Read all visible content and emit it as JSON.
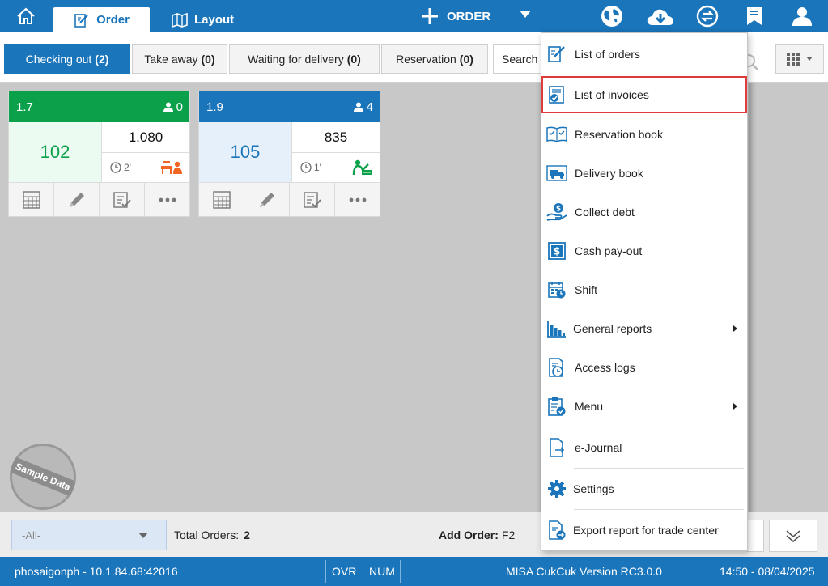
{
  "topbar": {
    "tabs": [
      {
        "label": "Order",
        "icon": "order-edit-icon",
        "active": true
      },
      {
        "label": "Layout",
        "icon": "map-icon",
        "active": false
      }
    ],
    "new_label": "ORDER",
    "icons": [
      "menu-icon",
      "globe-icon",
      "cloud-download-icon",
      "sync-icon",
      "bookmark-icon",
      "user-icon"
    ]
  },
  "status_tabs": [
    {
      "label": "Checking out",
      "count": "(2)",
      "active": true
    },
    {
      "label": "Take away",
      "count": "(0)",
      "active": false
    },
    {
      "label": "Waiting for delivery",
      "count": "(0)",
      "active": false
    },
    {
      "label": "Reservation",
      "count": "(0)",
      "active": false
    }
  ],
  "search": {
    "placeholder": "Search"
  },
  "orders": [
    {
      "table_no": "1.7",
      "guests": "0",
      "table_name": "102",
      "amount": "1.080",
      "elapsed": "2'",
      "header_color": "#0ba04a",
      "type_icon": "dine-in-icon"
    },
    {
      "table_no": "1.9",
      "guests": "4",
      "table_name": "105",
      "amount": "835",
      "elapsed": "1'",
      "header_color": "#1a75bb",
      "type_icon": "waiter-icon"
    }
  ],
  "stamp": "Sample Data",
  "bottom": {
    "filter_value": "-All-",
    "total_label": "Total Orders:",
    "total_value": "2",
    "add_order_label": "Add Order:",
    "add_order_key": "F2"
  },
  "footer": {
    "connection": "phosaigonph - 10.1.84.68:42016",
    "ovr": "OVR",
    "num": "NUM",
    "version": "MISA CukCuk Version RC3.0.0",
    "datetime": "14:50 - 08/04/2025"
  },
  "menu": {
    "items": [
      {
        "label": "List of orders",
        "icon": "order-list-icon"
      },
      {
        "label": "List of invoices",
        "icon": "invoice-list-icon",
        "highlighted": true
      },
      {
        "label": "Reservation book",
        "icon": "reservation-book-icon"
      },
      {
        "label": "Delivery book",
        "icon": "delivery-truck-icon"
      },
      {
        "label": "Collect debt",
        "icon": "collect-debt-icon"
      },
      {
        "label": "Cash pay-out",
        "icon": "cash-payout-icon"
      },
      {
        "label": "Shift",
        "icon": "shift-calendar-icon"
      },
      {
        "label": "General reports",
        "icon": "bar-chart-icon",
        "submenu": true
      },
      {
        "label": "Access logs",
        "icon": "access-log-icon"
      },
      {
        "label": "Menu",
        "icon": "menu-clipboard-icon",
        "submenu": true
      },
      {
        "label": "e-Journal",
        "icon": "e-journal-icon"
      },
      {
        "label": "Settings",
        "icon": "settings-gear-icon"
      },
      {
        "label": "Export report for trade center",
        "icon": "export-report-icon"
      }
    ]
  },
  "colors": {
    "brand": "#1a75bb",
    "dine_in": "#0ba04a",
    "highlight": "#e03b3b"
  }
}
